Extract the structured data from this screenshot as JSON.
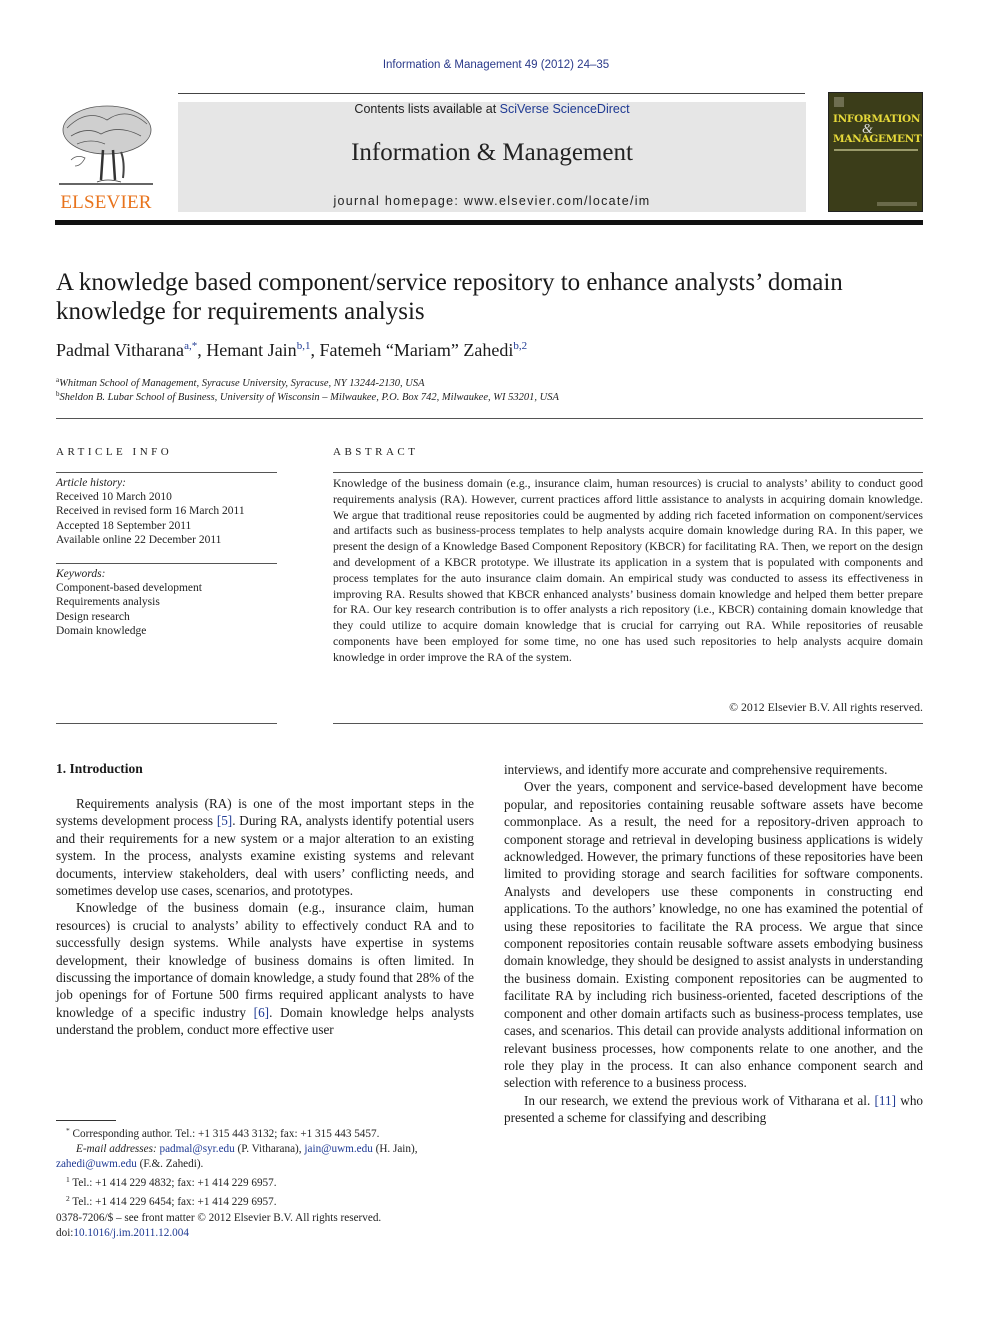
{
  "header": {
    "journal_ref": "Information & Management 49 (2012) 24–35",
    "contents_prefix": "Contents lists available at ",
    "contents_link": "SciVerse ScienceDirect",
    "journal_title": "Information & Management",
    "homepage_prefix": "journal homepage: ",
    "homepage_url": "www.elsevier.com/locate/im",
    "publisher_logo_text": "ELSEVIER",
    "cover": {
      "line1": "INFORMATION",
      "amp": "&",
      "line2": "MANAGEMENT"
    }
  },
  "article": {
    "title": "A knowledge based component/service repository to enhance analysts’ domain knowledge for requirements analysis",
    "authors": [
      {
        "name": "Padmal Vitharana",
        "sup": "a,*",
        "sep": ", "
      },
      {
        "name": "Hemant Jain",
        "sup": "b,1",
        "sep": ", "
      },
      {
        "name": "Fatemeh “Mariam” Zahedi",
        "sup": "b,2",
        "sep": ""
      }
    ],
    "affiliations": [
      {
        "mark": "a",
        "text": "Whitman School of Management, Syracuse University, Syracuse, NY 13244-2130, USA"
      },
      {
        "mark": "b",
        "text": "Sheldon B. Lubar School of Business, University of Wisconsin – Milwaukee, P.O. Box 742, Milwaukee, WI 53201, USA"
      }
    ]
  },
  "article_info": {
    "heading": "ARTICLE INFO",
    "history_label": "Article history:",
    "history": [
      "Received 10 March 2010",
      "Received in revised form 16 March 2011",
      "Accepted 18 September 2011",
      "Available online 22 December 2011"
    ],
    "keywords_label": "Keywords:",
    "keywords": [
      "Component-based development",
      "Requirements analysis",
      "Design research",
      "Domain knowledge"
    ]
  },
  "abstract": {
    "heading": "ABSTRACT",
    "text": "Knowledge of the business domain (e.g., insurance claim, human resources) is crucial to analysts’ ability to conduct good requirements analysis (RA). However, current practices afford little assistance to analysts in acquiring domain knowledge. We argue that traditional reuse repositories could be augmented by adding rich faceted information on component/services and artifacts such as business-process templates to help analysts acquire domain knowledge during RA. In this paper, we present the design of a Knowledge Based Component Repository (KBCR) for facilitating RA. Then, we report on the design and development of a KBCR prototype. We illustrate its application in a system that is populated with components and process templates for the auto insurance claim domain. An empirical study was conducted to assess its effectiveness in improving RA. Results showed that KBCR enhanced analysts’ business domain knowledge and helped them better prepare for RA. Our key research contribution is to offer analysts a rich repository (i.e., KBCR) containing domain knowledge that they could utilize to acquire domain knowledge that is crucial for carrying out RA. While repositories of reusable components have been employed for some time, no one has used such repositories to help analysts acquire domain knowledge in order improve the RA of the system.",
    "copyright": "© 2012 Elsevier B.V. All rights reserved."
  },
  "body": {
    "section_heading": "1.  Introduction",
    "left": {
      "p1_a": "Requirements analysis (RA) is one of the most important steps in the systems development process ",
      "p1_ref": "[5]",
      "p1_b": ". During RA, analysts identify potential users and their requirements for a new system or a major alteration to an existing system. In the process, analysts examine existing systems and relevant documents, interview stakeholders, deal with users’ conflicting needs, and sometimes develop use cases, scenarios, and prototypes.",
      "p2_a": "Knowledge of the business domain (e.g., insurance claim, human resources) is crucial to analysts’ ability to effectively conduct RA and to successfully design systems. While analysts have expertise in systems development, their knowledge of business domains is often limited. In discussing the importance of domain knowledge, a study found that 28% of the job openings for of Fortune 500 firms required applicant analysts to have knowledge of a specific industry ",
      "p2_ref": "[6]",
      "p2_b": ". Domain knowledge helps analysts understand the problem, conduct more effective user"
    },
    "right": {
      "p0": "interviews, and identify more accurate and comprehensive requirements.",
      "p1": "Over the years, component and service-based development have become popular, and repositories containing reusable software assets have become commonplace. As a result, the need for a repository-driven approach to component storage and retrieval in developing business applications is widely acknowledged. However, the primary functions of these repositories have been limited to providing storage and search facilities for software components. Analysts and developers use these components in constructing end applications. To the authors’ knowledge, no one has examined the potential of using these repositories to facilitate the RA process. We argue that since component repositories contain reusable software assets embodying business domain knowledge, they should be designed to assist analysts in understanding the business domain. Existing component repositories can be augmented to facilitate RA by including rich business-oriented, faceted descriptions of the component and other domain artifacts such as business-process templates, use cases, and scenarios. This detail can provide analysts additional information on relevant business processes, how components relate to one another, and the role they play in the process. It can also enhance component search and selection with reference to a business process.",
      "p2_a": "In our research, we extend the previous work of Vitharana et al. ",
      "p2_ref": "[11]",
      "p2_b": " who presented a scheme for classifying and describing"
    }
  },
  "footnotes": {
    "corr_mark": "*",
    "corr_text": "Corresponding author. Tel.: +1 315 443 3132; fax: +1 315 443 5457.",
    "email_label": "E-mail addresses:",
    "emails": [
      {
        "addr": "padmal@syr.edu",
        "who": " (P. Vitharana), "
      },
      {
        "addr": "jain@uwm.edu",
        "who": " (H. Jain),"
      },
      {
        "addr": "zahedi@uwm.edu",
        "who": " (F.&. Zahedi)."
      }
    ],
    "fn1_mark": "1",
    "fn1": "Tel.: +1 414 229 4832; fax: +1 414 229 6957.",
    "fn2_mark": "2",
    "fn2": "Tel.: +1 414 229 6454; fax: +1 414 229 6957."
  },
  "front_matter": {
    "issn": "0378-7206/$ – see front matter © 2012 Elsevier B.V. All rights reserved.",
    "doi_label": "doi:",
    "doi": "10.1016/j.im.2011.12.004"
  }
}
